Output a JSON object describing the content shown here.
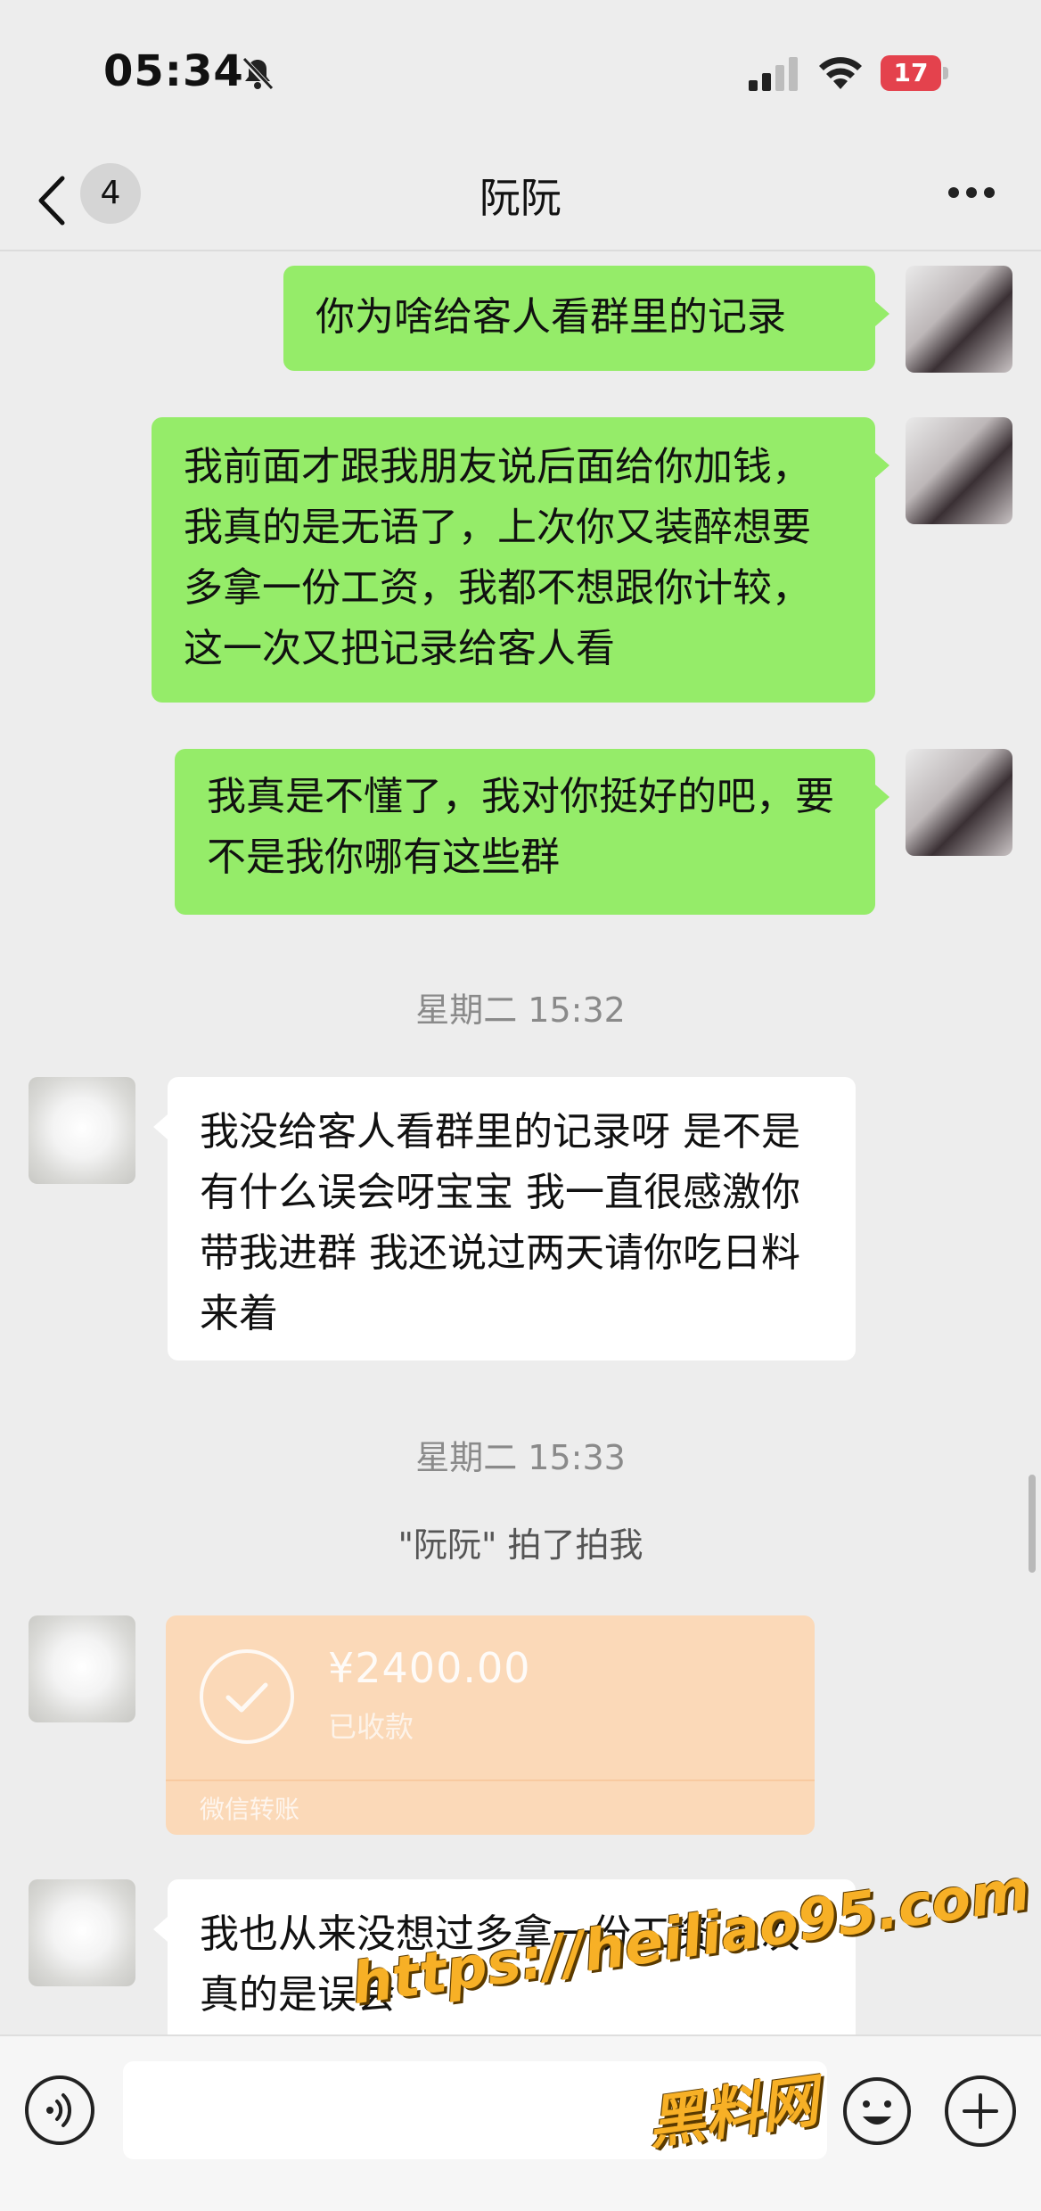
{
  "status_bar": {
    "time": "05:34",
    "battery": "17"
  },
  "nav": {
    "unread_count": "4",
    "title": "阮阮"
  },
  "messages": [
    {
      "from": "self",
      "text": "你为啥给客人看群里的记录"
    },
    {
      "from": "self",
      "text": "我前面才跟我朋友说后面给你加钱，我真的是无语了，上次你又装醉想要多拿一份工资，我都不想跟你计较，这一次又把记录给客人看"
    },
    {
      "from": "self",
      "text": "我真是不懂了，我对你挺好的吧，要不是我你哪有这些群"
    },
    {
      "timestamp": "星期二 15:32"
    },
    {
      "from": "other",
      "text": "我没给客人看群里的记录呀 是不是有什么误会呀宝宝 我一直很感激你带我进群 我还说过两天请你吃日料来着"
    },
    {
      "timestamp": "星期二 15:33"
    },
    {
      "system": "\"阮阮\" 拍了拍我"
    },
    {
      "from": "other",
      "transfer": {
        "amount": "¥2400.00",
        "status": "已收款",
        "label": "微信转账"
      }
    },
    {
      "from": "other",
      "text": "我也从来没想过多拿一份工资 上次真的是误会"
    }
  ],
  "watermark": {
    "line1": "https://heiliao95.com",
    "line2": "黑料网"
  },
  "colors": {
    "self_bubble": "#95ec69",
    "other_bubble": "#ffffff",
    "transfer_card": "#fbd9b8",
    "background": "#ededed",
    "battery": "#e4424d"
  },
  "icons": [
    "bell-slash-icon",
    "signal-icon",
    "wifi-icon",
    "battery-icon",
    "back-chevron-icon",
    "more-dots-icon",
    "voice-icon",
    "emoji-icon",
    "plus-icon",
    "check-icon"
  ]
}
